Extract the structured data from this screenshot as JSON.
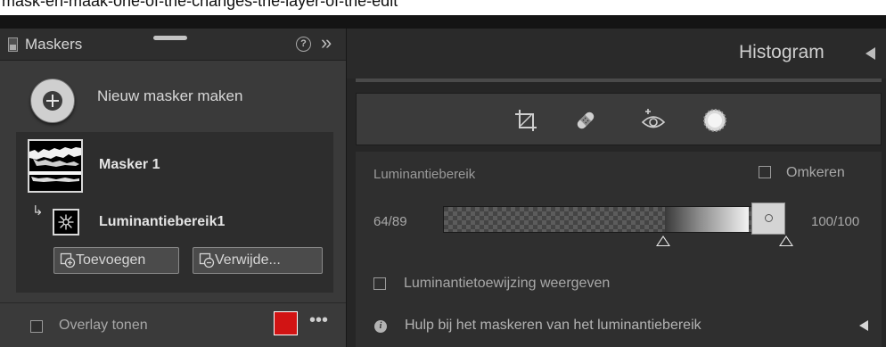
{
  "page_caption": "mask-en-maak-one-of-the-changes-the-layer-of-the-edit",
  "masks_panel": {
    "title": "Maskers",
    "new_mask_label": "Nieuw masker maken",
    "masks": [
      {
        "name": "Masker 1"
      }
    ],
    "sub_component": {
      "name": "Luminantiebereik1"
    },
    "add_button_label": "Toevoegen",
    "remove_button_label": "Verwijde...",
    "overlay_label": "Overlay tonen",
    "overlay_color": "#d11414",
    "more_icon_glyph": "•••"
  },
  "histogram_panel": {
    "title": "Histogram",
    "tools": [
      "crop-icon",
      "heal-icon",
      "red-eye-icon",
      "mask-icon"
    ]
  },
  "luminance_range": {
    "label": "Luminantiebereik",
    "invert_label": "Omkeren",
    "invert_checked": false,
    "left_value": "64/89",
    "right_value": "100/100",
    "show_luminance_map_label": "Luminantietoewijzing weergeven",
    "show_luminance_map_checked": false,
    "help_label": "Hulp bij het maskeren van het luminantiebereik"
  },
  "colors": {
    "panel_bg": "#3a3a3a",
    "right_bg": "#262626",
    "accent_red": "#d11414"
  }
}
